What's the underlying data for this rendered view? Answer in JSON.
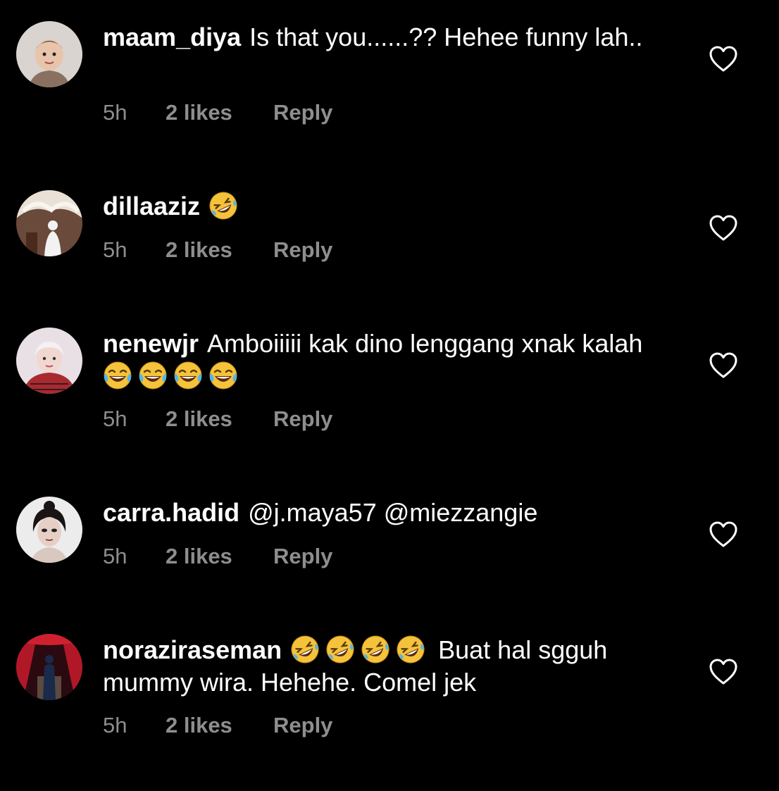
{
  "comments": [
    {
      "username": "maam_diya",
      "text": "Is that you......?? Hehee  funny lah..",
      "emojis": [],
      "time": "5h",
      "likes": "2 likes",
      "reply": "Reply"
    },
    {
      "username": "dillaaziz",
      "text": "",
      "emojis": [
        "rofl-emoji"
      ],
      "time": "5h",
      "likes": "2 likes",
      "reply": "Reply"
    },
    {
      "username": "nenewjr",
      "text": "Amboiiiii kak dino lenggang xnak kalah",
      "emojis": [
        "joy-emoji",
        "joy-emoji",
        "joy-emoji",
        "joy-emoji"
      ],
      "time": "5h",
      "likes": "2 likes",
      "reply": "Reply"
    },
    {
      "username": "carra.hadid",
      "text": "@j.maya57 @miezzangie",
      "emojis": [],
      "time": "5h",
      "likes": "2 likes",
      "reply": "Reply"
    },
    {
      "username": "noraziraseman",
      "text_after_emojis": "Buat hal sgguh mummy wira. Hehehe. Comel jek",
      "emojis": [
        "rofl-emoji",
        "rofl-emoji",
        "rofl-emoji",
        "rofl-emoji"
      ],
      "time": "5h",
      "likes": "2 likes",
      "reply": "Reply"
    }
  ],
  "colors": {
    "background": "#000000",
    "text": "#ffffff",
    "meta": "#8e8e8e",
    "emoji_face": "#f5c33b"
  },
  "icons": {
    "like": "heart-outline-icon"
  }
}
